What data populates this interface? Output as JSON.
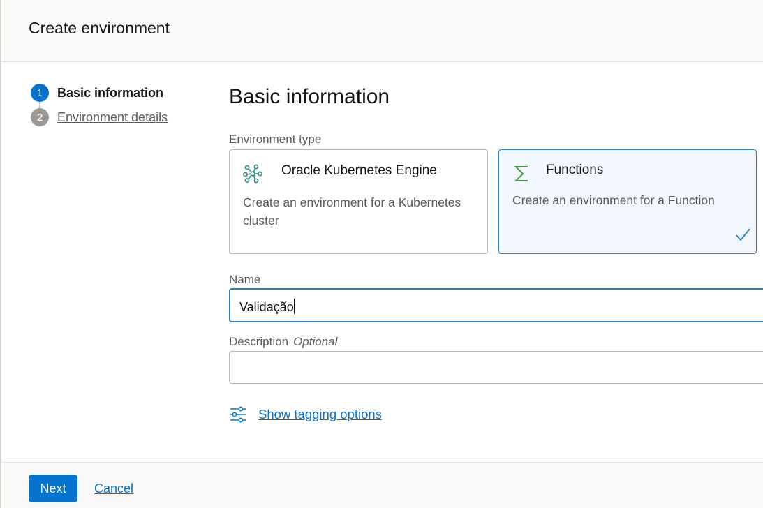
{
  "dialog": {
    "title": "Create environment"
  },
  "stepper": {
    "steps": [
      {
        "number": "1",
        "label": "Basic information",
        "state": "current"
      },
      {
        "number": "2",
        "label": "Environment details",
        "state": "upcoming"
      }
    ]
  },
  "form": {
    "section_title": "Basic information",
    "environment_type": {
      "label": "Environment type",
      "options": [
        {
          "icon": "kubernetes-cluster-icon",
          "title": "Oracle Kubernetes Engine",
          "description": "Create an environment for a Kubernetes cluster",
          "selected": false
        },
        {
          "icon": "sigma-function-icon",
          "title": "Functions",
          "description": "Create an environment for a Function",
          "selected": true
        }
      ]
    },
    "name": {
      "label": "Name",
      "value": "Validação"
    },
    "description": {
      "label": "Description",
      "optional_label": "Optional",
      "value": ""
    },
    "tagging": {
      "icon": "sliders-icon",
      "link_label": "Show tagging options"
    }
  },
  "footer": {
    "next_label": "Next",
    "cancel_label": "Cancel"
  },
  "colors": {
    "primary": "#0572ce",
    "selected_border": "#2a7fbf",
    "selected_bg": "#f1f7fc",
    "icon_teal": "#2a8a83",
    "icon_green": "#4c9b45"
  }
}
